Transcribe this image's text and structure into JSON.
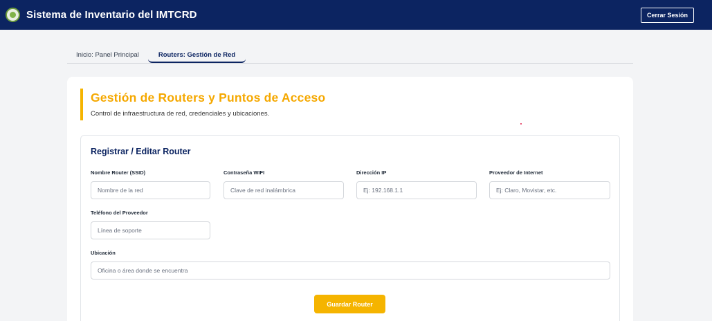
{
  "header": {
    "app_title": "Sistema de Inventario del IMTCRD",
    "logout_label": "Cerrar Sesión"
  },
  "tabs": [
    {
      "label": "Inicio: Panel Principal",
      "active": false
    },
    {
      "label": "Routers: Gestión de Red",
      "active": true
    }
  ],
  "page": {
    "title": "Gestión de Routers y Puntos de Acceso",
    "subtitle": "Control de infraestructura de red, credenciales y ubicaciones."
  },
  "form": {
    "title": "Registrar / Editar Router",
    "fields": {
      "ssid": {
        "label": "Nombre Router (SSID)",
        "placeholder": "Nombre de la red",
        "value": ""
      },
      "password": {
        "label": "Contraseña WIFI",
        "placeholder": "Clave de red inalámbrica",
        "value": ""
      },
      "ip": {
        "label": "Dirección IP",
        "placeholder": "Ej: 192.168.1.1",
        "value": ""
      },
      "provider": {
        "label": "Proveedor de Internet",
        "placeholder": "Ej: Claro, Movistar, etc.",
        "value": ""
      },
      "provider_phone": {
        "label": "Teléfono del Proveedor",
        "placeholder": "Línea de soporte",
        "value": ""
      },
      "location": {
        "label": "Ubicación",
        "placeholder": "Oficina o área donde se encuentra",
        "value": ""
      }
    },
    "save_label": "Guardar Router"
  },
  "colors": {
    "navbar": "#0c2461",
    "accent": "#f5b400",
    "background": "#f3f4f6"
  },
  "icons": {
    "logo": "imtcrd-logo-icon"
  }
}
